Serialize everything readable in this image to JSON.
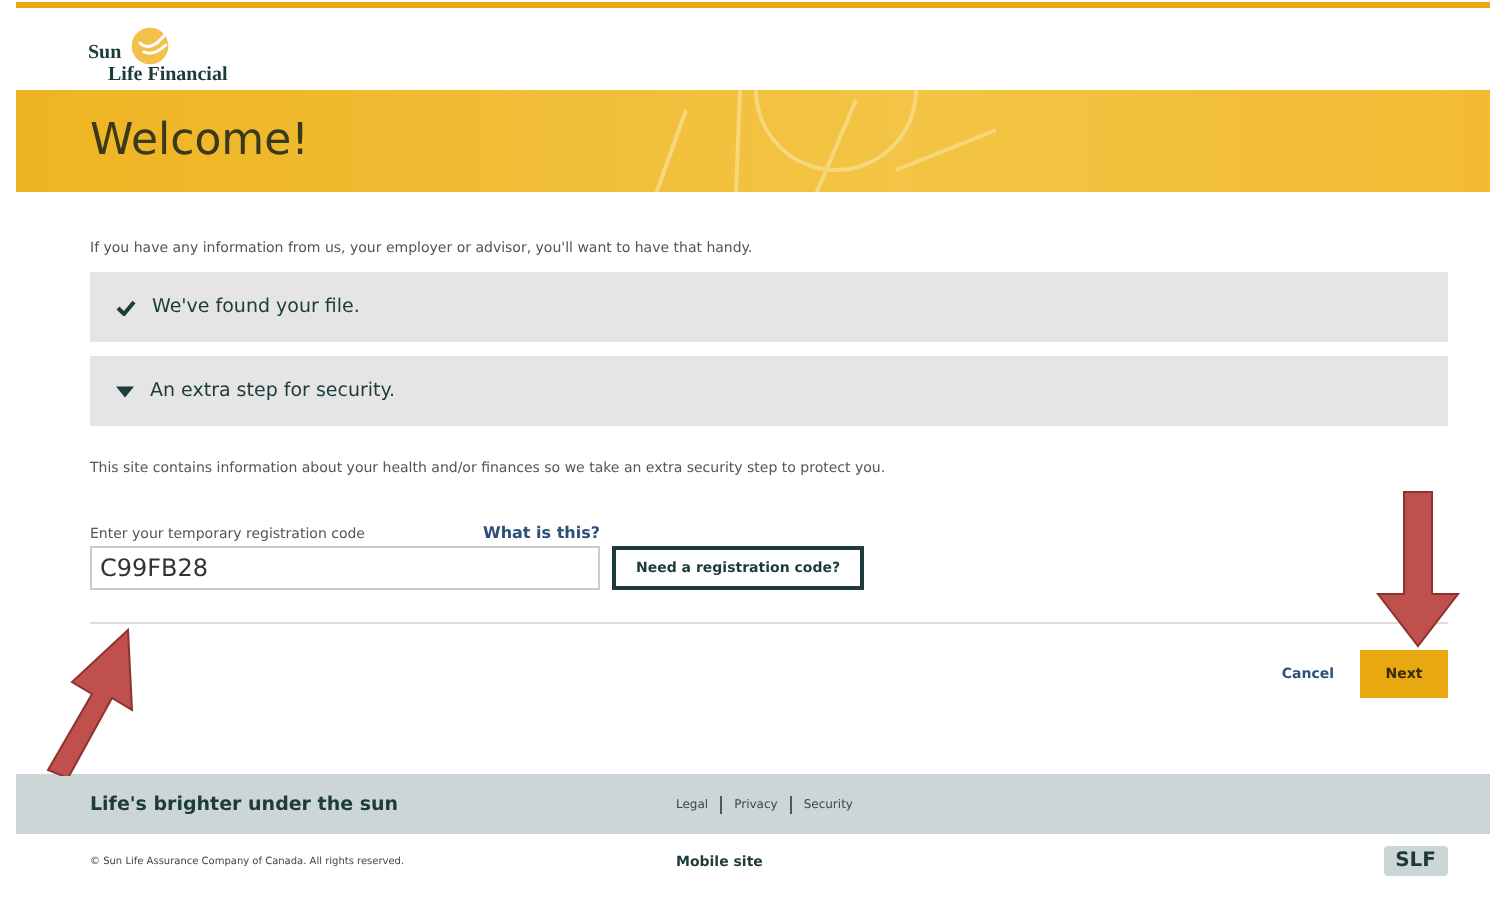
{
  "logo": {
    "line_1": "Sun",
    "line_2": "Life Financial"
  },
  "banner": {
    "title": "Welcome!"
  },
  "intro": "If you have any information from us, your employer or advisor, you'll want to have that handy.",
  "steps": [
    {
      "kind": "done",
      "label": "We've found your file."
    },
    {
      "kind": "open",
      "label": "An extra step for security."
    }
  ],
  "security_text": "This site contains information about your health and/or finances so we take an extra security step to protect you.",
  "code_field": {
    "label": "Enter your temporary registration code",
    "help_link": "What is this?",
    "value": "C99FB28"
  },
  "need_code_button": "Need a registration code?",
  "actions": {
    "cancel": "Cancel",
    "next": "Next"
  },
  "footer": {
    "tagline": "Life's brighter under the sun",
    "links": [
      "Legal",
      "Privacy",
      "Security"
    ],
    "copyright": "© Sun Life Assurance Company of Canada. All rights reserved.",
    "mobile_link": "Mobile site",
    "badge": "SLF"
  }
}
